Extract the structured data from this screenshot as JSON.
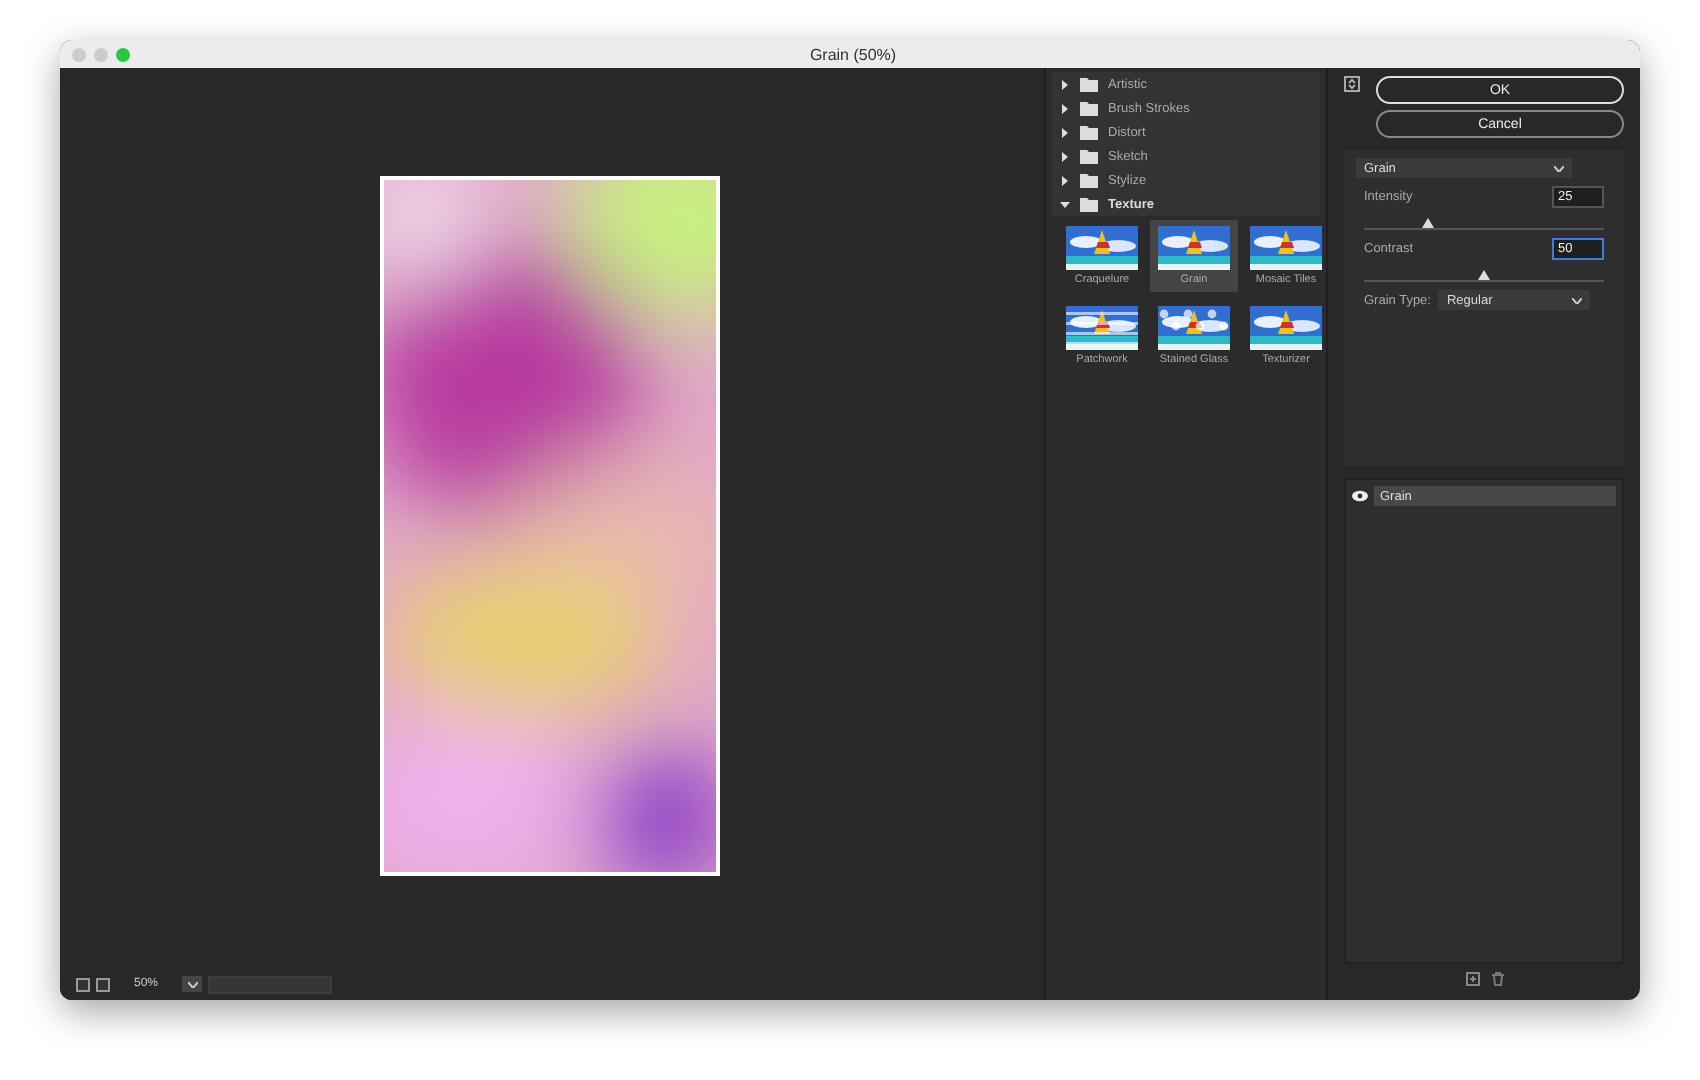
{
  "window": {
    "title": "Grain (50%)"
  },
  "zoom": {
    "value": "50%"
  },
  "folders": [
    {
      "name": "Artistic",
      "expanded": false
    },
    {
      "name": "Brush Strokes",
      "expanded": false
    },
    {
      "name": "Distort",
      "expanded": false
    },
    {
      "name": "Sketch",
      "expanded": false
    },
    {
      "name": "Stylize",
      "expanded": false
    },
    {
      "name": "Texture",
      "expanded": true,
      "filters": [
        {
          "name": "Craquelure",
          "selected": false,
          "kind": "plain"
        },
        {
          "name": "Grain",
          "selected": true,
          "kind": "plain"
        },
        {
          "name": "Mosaic Tiles",
          "selected": false,
          "kind": "plain"
        },
        {
          "name": "Patchwork",
          "selected": false,
          "kind": "striped"
        },
        {
          "name": "Stained Glass",
          "selected": false,
          "kind": "cells"
        },
        {
          "name": "Texturizer",
          "selected": false,
          "kind": "plain"
        }
      ]
    }
  ],
  "buttons": {
    "ok": "OK",
    "cancel": "Cancel"
  },
  "filter_select": {
    "value": "Grain"
  },
  "params": [
    {
      "label": "Intensity",
      "value": "25",
      "level": 0.27,
      "focused": false
    },
    {
      "label": "Contrast",
      "value": "50",
      "level": 0.5,
      "focused": true
    }
  ],
  "grain_type": {
    "label": "Grain Type:",
    "value": "Regular"
  },
  "layers": [
    {
      "name": "Grain",
      "visible": true
    }
  ]
}
